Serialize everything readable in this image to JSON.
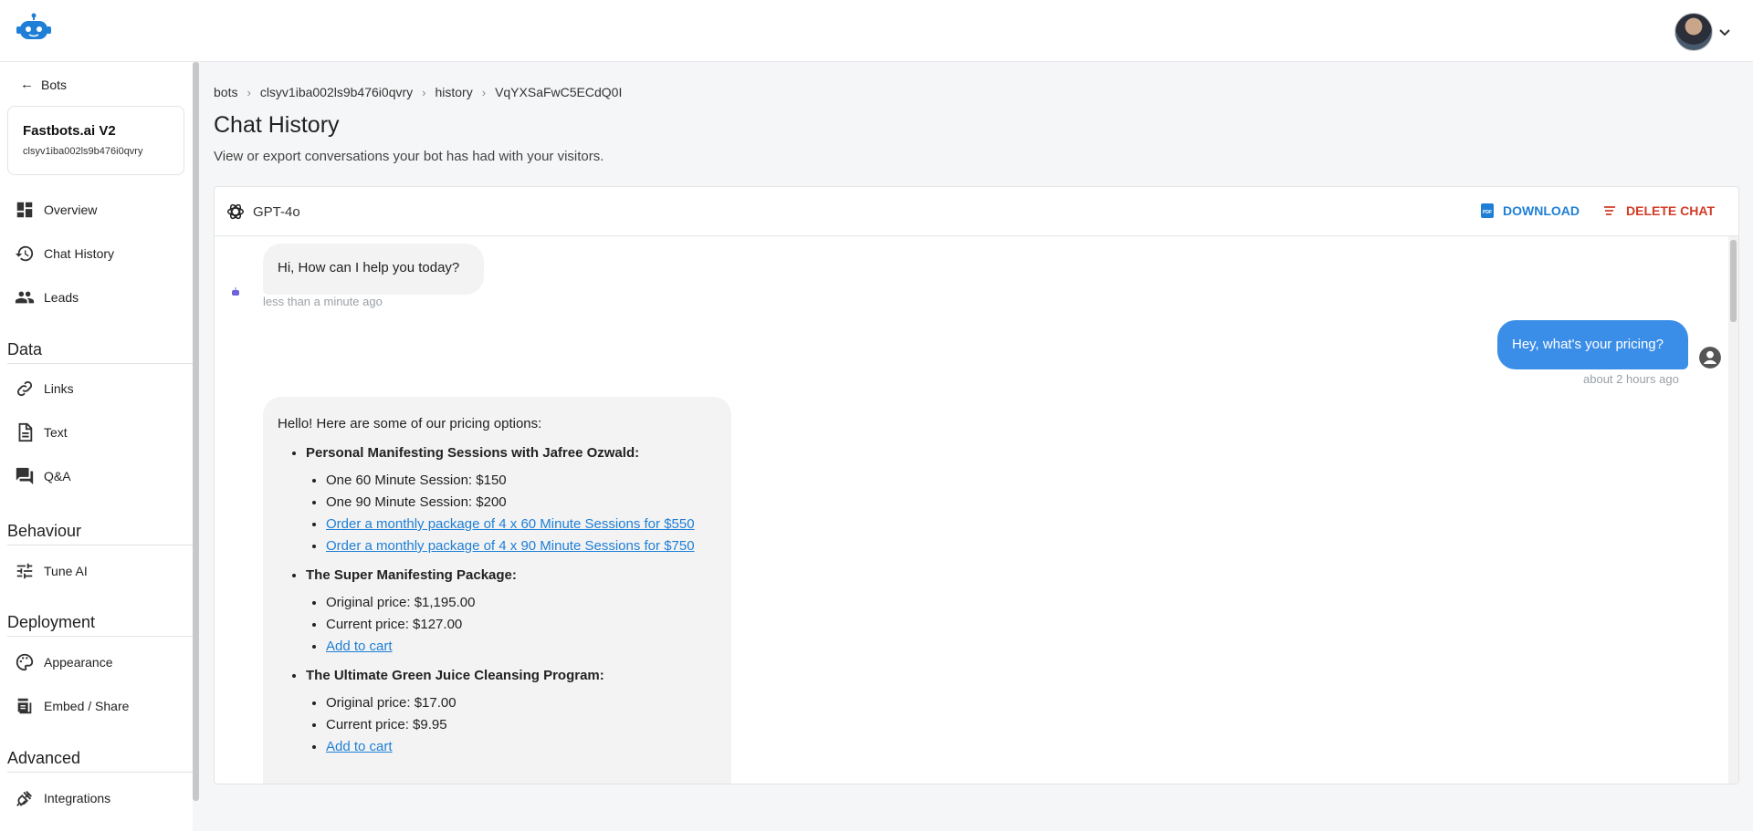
{
  "topbar": {
    "logo": "robot-logo-icon",
    "avatar": "user-avatar",
    "menu_icon": "chevron-down-icon"
  },
  "sidebar": {
    "back_label": "Bots",
    "bot": {
      "name": "Fastbots.ai V2",
      "id": "clsyv1iba002ls9b476i0qvry"
    },
    "items_top": [
      {
        "label": "Overview",
        "icon": "dashboard-icon"
      },
      {
        "label": "Chat History",
        "icon": "history-icon"
      },
      {
        "label": "Leads",
        "icon": "people-icon"
      }
    ],
    "sections": {
      "data": {
        "title": "Data",
        "items": [
          {
            "label": "Links",
            "icon": "link-icon"
          },
          {
            "label": "Text",
            "icon": "document-icon"
          },
          {
            "label": "Q&A",
            "icon": "forum-icon"
          }
        ]
      },
      "behaviour": {
        "title": "Behaviour",
        "items": [
          {
            "label": "Tune AI",
            "icon": "tune-icon"
          }
        ]
      },
      "deployment": {
        "title": "Deployment",
        "items": [
          {
            "label": "Appearance",
            "icon": "palette-icon"
          },
          {
            "label": "Embed / Share",
            "icon": "embed-icon"
          }
        ]
      },
      "advanced": {
        "title": "Advanced",
        "items": [
          {
            "label": "Integrations",
            "icon": "plug-icon"
          }
        ]
      }
    }
  },
  "breadcrumb": [
    "bots",
    "clsyv1iba002ls9b476i0qvry",
    "history",
    "VqYXSaFwC5ECdQ0I"
  ],
  "page": {
    "title": "Chat History",
    "subtitle": "View or export conversations your bot has had with your visitors."
  },
  "chat": {
    "model": "GPT-4o",
    "download_label": "DOWNLOAD",
    "delete_label": "DELETE CHAT",
    "messages": {
      "greeting": {
        "text": "Hi, How can I help you today?",
        "time": "less than a minute ago"
      },
      "user": {
        "text": "Hey, what's your pricing?",
        "time": "about 2 hours ago"
      },
      "reply": {
        "intro": "Hello! Here are some of our pricing options:",
        "groups": [
          {
            "title": "Personal Manifesting Sessions with Jafree Ozwald:",
            "items": [
              {
                "text": "One 60 Minute Session: $150",
                "link": false
              },
              {
                "text": "One 90 Minute Session: $200",
                "link": false
              },
              {
                "text": "Order a monthly package of 4 x 60 Minute Sessions for $550",
                "link": true
              },
              {
                "text": "Order a monthly package of 4 x 90 Minute Sessions for $750",
                "link": true
              }
            ]
          },
          {
            "title": "The Super Manifesting Package:",
            "items": [
              {
                "text": "Original price: $1,195.00",
                "link": false
              },
              {
                "text": "Current price: $127.00",
                "link": false
              },
              {
                "text": "Add to cart",
                "link": true
              }
            ]
          },
          {
            "title": "The Ultimate Green Juice Cleansing Program:",
            "items": [
              {
                "text": "Original price: $17.00",
                "link": false
              },
              {
                "text": "Current price: $9.95",
                "link": false
              },
              {
                "text": "Add to cart",
                "link": true
              }
            ]
          }
        ]
      }
    }
  },
  "colors": {
    "accent": "#1f7fd6",
    "danger": "#d23b27",
    "user_bubble": "#3b8ee8",
    "bot_bubble": "#f3f3f3"
  }
}
